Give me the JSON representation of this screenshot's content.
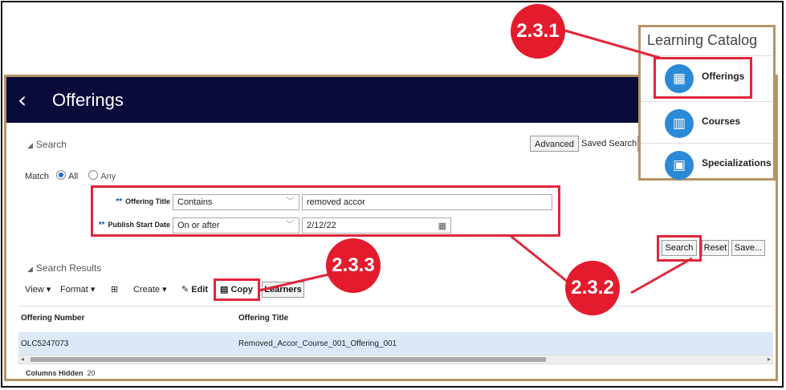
{
  "header": {
    "back_glyph": "‹",
    "title": "Offerings"
  },
  "search": {
    "label": "Search",
    "advanced": "Advanced",
    "saved_search": "Saved Search",
    "match_label": "Match",
    "match_all": "All",
    "match_any": "Any",
    "offering_title": {
      "label": "Offering Title",
      "operator": "Contains",
      "value": "removed accor"
    },
    "publish_start": {
      "label": "Publish Start Date",
      "operator": "On or after",
      "value": "2/12/22"
    },
    "buttons": {
      "search": "Search",
      "reset": "Reset",
      "save": "Save..."
    }
  },
  "results": {
    "label": "Search Results",
    "toolbar": {
      "view": "View ▾",
      "format": "Format ▾",
      "create": "Create ▾",
      "edit": "Edit",
      "copy": "Copy",
      "learners": "Learners"
    },
    "columns": [
      "Offering Number",
      "Offering Title"
    ],
    "rows": [
      {
        "number": "OLC5247073",
        "title": "Removed_Accor_Course_001_Offering_001"
      }
    ],
    "columns_hidden_label": "Columns Hidden",
    "columns_hidden_count": "20"
  },
  "catalog": {
    "title": "Learning Catalog",
    "items": [
      {
        "label": "Offerings",
        "icon": "calendar-icon"
      },
      {
        "label": "Courses",
        "icon": "notebook-icon"
      },
      {
        "label": "Specializations",
        "icon": "certificate-icon"
      }
    ]
  },
  "annotations": {
    "a1": "2.3.1",
    "a2": "2.3.2",
    "a3": "2.3.3"
  },
  "colors": {
    "header": "#0b0b3b",
    "highlight": "#e0263a",
    "frame": "#b39567",
    "selected_row": "#dbe9f7",
    "icon": "#2b8ad8"
  }
}
